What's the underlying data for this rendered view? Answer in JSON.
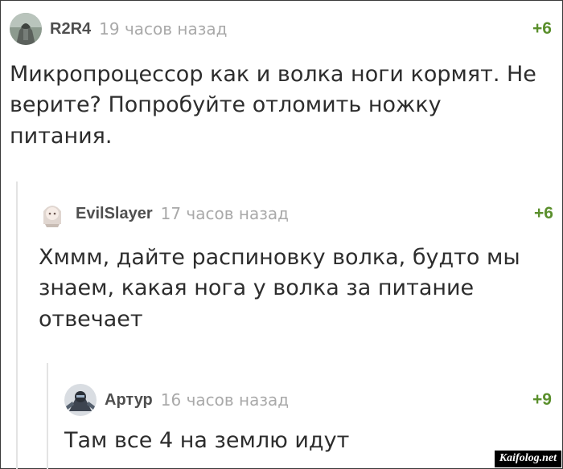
{
  "comments": [
    {
      "avatar_icon": "gargoyle-avatar-icon",
      "author": "R2R4",
      "time": "19 часов назад",
      "rating": "+6",
      "text": "Микропроцессор как и волка ноги кормят. Не верите? Попробуйте отломить ножку питания."
    },
    {
      "avatar_icon": "anime-girl-avatar-icon",
      "author": "EvilSlayer",
      "time": "17 часов назад",
      "rating": "+6",
      "text": "Хммм, дайте распиновку волка, будто мы знаем, какая нога у волка за питание отвечает"
    },
    {
      "avatar_icon": "robot-avatar-icon",
      "author": "Артур",
      "time": "16 часов назад",
      "rating": "+9",
      "text": "Там все 4 на землю идут"
    }
  ],
  "watermark": "Kaifolog.net",
  "colors": {
    "rating": "#5a8f2c",
    "time": "#a9a9a9",
    "author": "#4f4f4f",
    "text": "#2d2d2d",
    "thread_line": "#e3e3e3"
  }
}
